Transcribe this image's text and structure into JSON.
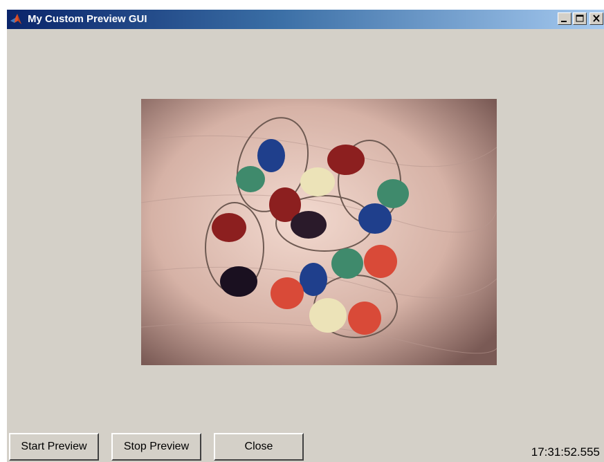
{
  "window": {
    "title": "My Custom Preview GUI",
    "icon": "matlab-logo-icon",
    "controls": [
      "minimize-icon",
      "maximize-icon",
      "close-icon"
    ]
  },
  "preview": {
    "description_icon": "video-preview-image"
  },
  "buttons": {
    "start_label": "Start Preview",
    "stop_label": "Stop Preview",
    "close_label": "Close"
  },
  "status": {
    "timestamp": "17:31:52.555"
  },
  "colors": {
    "titlebar_start": "#0a246a",
    "titlebar_end": "#a6caf0",
    "window_bg": "#d4d0c8"
  }
}
